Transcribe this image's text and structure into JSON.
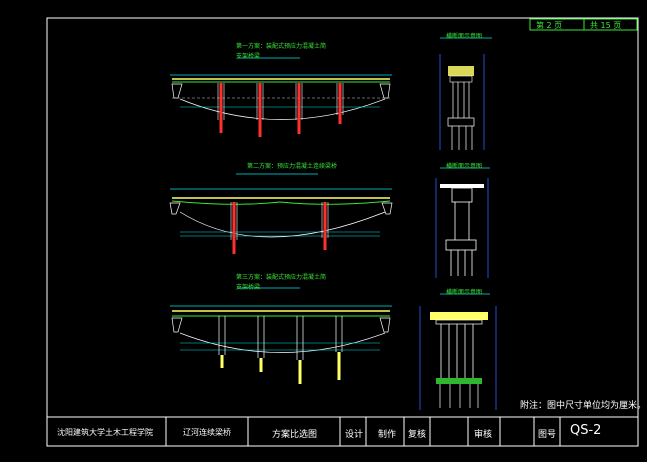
{
  "sheet": {
    "page": "第 2 页",
    "total": "共 15 页"
  },
  "schemes": [
    {
      "title": "第一方案：装配式预应力混凝土简",
      "subtitle": "支架桥梁"
    },
    {
      "title": "第二方案：预应力混凝土连续梁桥",
      "subtitle": ""
    },
    {
      "title": "第三方案：装配式预应力混凝土简",
      "subtitle": "支架桥梁"
    }
  ],
  "sections": [
    {
      "title": "横断面示意图"
    },
    {
      "title": "横断面示意图"
    },
    {
      "title": "横断面示意图"
    }
  ],
  "note": "附注：图中尺寸单位均为厘米。",
  "titleblock": {
    "school": "沈阳建筑大学土木工程学院",
    "project": "辽河连续梁桥",
    "drawing": "方案比选图",
    "design": "设计",
    "drawn": "制作",
    "check": "复核",
    "review": "审核",
    "sheet_no_label": "图号",
    "sheet_no": "QS-2"
  }
}
